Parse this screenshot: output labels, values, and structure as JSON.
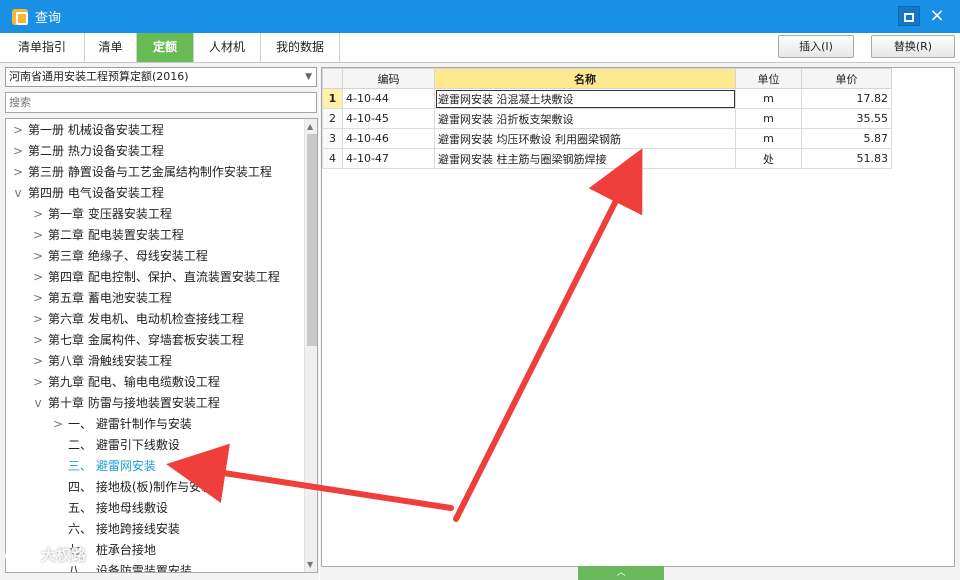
{
  "window": {
    "title": "查询",
    "max_label": "",
    "close_label": "×"
  },
  "tabs": [
    {
      "label": "清单指引",
      "active": false
    },
    {
      "label": "清单",
      "active": false
    },
    {
      "label": "定额",
      "active": true
    },
    {
      "label": "人材机",
      "active": false
    },
    {
      "label": "我的数据",
      "active": false
    }
  ],
  "actions": {
    "insert": "插入(I)",
    "replace": "替换(R)"
  },
  "library": {
    "selected": "河南省通用安装工程预算定额(2016)",
    "caret": "▼"
  },
  "search": {
    "placeholder": "搜索",
    "value": ""
  },
  "tree": [
    {
      "label": "第一册 机械设备安装工程",
      "level": 0,
      "arrow": ">"
    },
    {
      "label": "第二册 热力设备安装工程",
      "level": 0,
      "arrow": ">"
    },
    {
      "label": "第三册 静置设备与工艺金属结构制作安装工程",
      "level": 0,
      "arrow": ">"
    },
    {
      "label": "第四册 电气设备安装工程",
      "level": 0,
      "arrow": "v"
    },
    {
      "label": "第一章 变压器安装工程",
      "level": 1,
      "arrow": ">"
    },
    {
      "label": "第二章 配电装置安装工程",
      "level": 1,
      "arrow": ">"
    },
    {
      "label": "第三章 绝缘子、母线安装工程",
      "level": 1,
      "arrow": ">"
    },
    {
      "label": "第四章 配电控制、保护、直流装置安装工程",
      "level": 1,
      "arrow": ">"
    },
    {
      "label": "第五章 蓄电池安装工程",
      "level": 1,
      "arrow": ">"
    },
    {
      "label": "第六章 发电机、电动机检查接线工程",
      "level": 1,
      "arrow": ">"
    },
    {
      "label": "第七章 金属构件、穿墙套板安装工程",
      "level": 1,
      "arrow": ">"
    },
    {
      "label": "第八章 滑触线安装工程",
      "level": 1,
      "arrow": ">"
    },
    {
      "label": "第九章 配电、输电电缆敷设工程",
      "level": 1,
      "arrow": ">"
    },
    {
      "label": "第十章 防雷与接地装置安装工程",
      "level": 1,
      "arrow": "v"
    },
    {
      "label": "一、 避雷针制作与安装",
      "level": 2,
      "arrow": ">"
    },
    {
      "label": "二、 避雷引下线敷设",
      "level": 2,
      "arrow": ""
    },
    {
      "label": "三、 避雷网安装",
      "level": 2,
      "arrow": "",
      "selected": true
    },
    {
      "label": "四、 接地极(板)制作与安装",
      "level": 2,
      "arrow": ""
    },
    {
      "label": "五、 接地母线敷设",
      "level": 2,
      "arrow": ""
    },
    {
      "label": "六、 接地跨接线安装",
      "level": 2,
      "arrow": ""
    },
    {
      "label": "七、 桩承台接地",
      "level": 2,
      "arrow": ""
    },
    {
      "label": "八、 设备防雷装置安装",
      "level": 2,
      "arrow": ""
    }
  ],
  "scroll": {
    "up": "▲",
    "down": "▼"
  },
  "grid": {
    "headers": [
      "",
      "编码",
      "名称",
      "单位",
      "单价"
    ],
    "rows": [
      {
        "num": "1",
        "code": "4-10-44",
        "name": "避雷网安装 沿混凝土块敷设",
        "unit": "m",
        "price": "17.82"
      },
      {
        "num": "2",
        "code": "4-10-45",
        "name": "避雷网安装 沿折板支架敷设",
        "unit": "m",
        "price": "35.55"
      },
      {
        "num": "3",
        "code": "4-10-46",
        "name": "避雷网安装 均压环敷设 利用圈梁钢筋",
        "unit": "m",
        "price": "5.87"
      },
      {
        "num": "4",
        "code": "4-10-47",
        "name": "避雷网安装 柱主筋与圈梁钢筋焊接",
        "unit": "处",
        "price": "51.83"
      }
    ]
  },
  "watermark": {
    "text": "大权路"
  },
  "splitter": {
    "label": "︿"
  },
  "colors": {
    "titlebar": "#1a8fe6",
    "active_tab": "#68ba55",
    "selected_tree": "#1b9ed6",
    "arrows": "#ef3f3b"
  },
  "icons": [
    "app-icon",
    "maximize-icon",
    "close-icon",
    "chevron-right-icon",
    "chevron-down-icon"
  ]
}
